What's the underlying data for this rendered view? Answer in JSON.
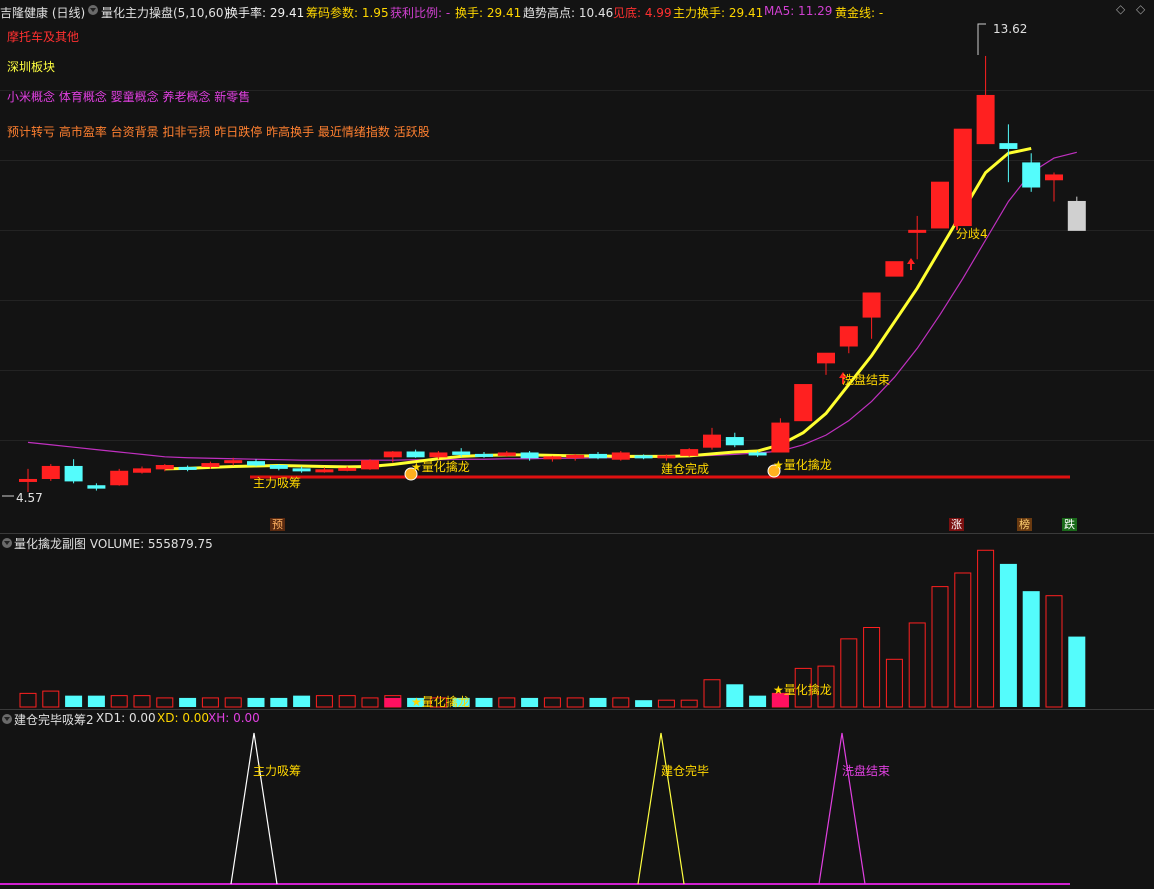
{
  "header": {
    "stock_title": "吉隆健康 (日线)",
    "indicator": "量化主力操盘(5,10,60)",
    "turnover": "换手率: 29.41",
    "chip_param": "筹码参数: 1.95",
    "profit_ratio": "获利比例: -",
    "hand": "换手: 29.41",
    "trend_high": "趋势高点: 10.46",
    "bottom": "见底: 4.99",
    "main_hand": "主力换手: 29.41",
    "ma5": "MA5: 11.29",
    "gold_line": "黄金线: -"
  },
  "tags": {
    "line1": "摩托车及其他",
    "line2": "深圳板块",
    "line3": "小米概念  体育概念  婴童概念  养老概念  新零售",
    "line4": "预计转亏  高市盈率  台资背景  扣非亏损  昨日跌停  昨高换手  最近情绪指数  活跃股"
  },
  "price_labels": {
    "high": "13.62",
    "low": "4.57"
  },
  "annotations": {
    "accum": "主力吸筹",
    "qinlong1": "★量化擒龙",
    "jiancang": "建仓完成",
    "qinlong2": "★量化擒龙",
    "xipan": "洗盘结束",
    "fenqi": "分歧4"
  },
  "bottom_tags": {
    "yu": "预",
    "zhang": "涨",
    "bang": "榜",
    "die": "跌"
  },
  "volume_panel": {
    "title": "量化擒龙副图  VOLUME: 555879.75",
    "qinlong1": "★量化擒龙",
    "qinlong2": "★量化擒龙"
  },
  "sub_panel": {
    "title": "建仓完毕吸筹2",
    "xd1": "XD1: 0.00",
    "xd": "XD: 0.00",
    "xh": "XH: 0.00",
    "peak1": "主力吸筹",
    "peak2": "建仓完毕",
    "peak3": "洗盘结束"
  },
  "colors": {
    "up": "#ff2020",
    "down": "#54fcfc",
    "ma_yellow": "#ffff30",
    "ma_magenta": "#c030c0",
    "support": "#e01010"
  },
  "chart_data": {
    "type": "candlestick",
    "candles": [
      {
        "o": 4.8,
        "h": 5.05,
        "l": 4.57,
        "c": 4.83
      },
      {
        "o": 4.85,
        "h": 5.15,
        "l": 4.8,
        "c": 5.1
      },
      {
        "o": 5.1,
        "h": 5.25,
        "l": 4.75,
        "c": 4.8
      },
      {
        "o": 4.7,
        "h": 4.75,
        "l": 4.6,
        "c": 4.65
      },
      {
        "o": 4.72,
        "h": 5.05,
        "l": 4.7,
        "c": 5.0
      },
      {
        "o": 4.98,
        "h": 5.1,
        "l": 4.95,
        "c": 5.05
      },
      {
        "o": 5.05,
        "h": 5.15,
        "l": 5.0,
        "c": 5.12
      },
      {
        "o": 5.08,
        "h": 5.12,
        "l": 5.0,
        "c": 5.06
      },
      {
        "o": 5.1,
        "h": 5.2,
        "l": 5.05,
        "c": 5.16
      },
      {
        "o": 5.18,
        "h": 5.28,
        "l": 5.12,
        "c": 5.22
      },
      {
        "o": 5.2,
        "h": 5.25,
        "l": 5.1,
        "c": 5.13
      },
      {
        "o": 5.12,
        "h": 5.15,
        "l": 5.02,
        "c": 5.06
      },
      {
        "o": 5.05,
        "h": 5.1,
        "l": 4.97,
        "c": 5.02
      },
      {
        "o": 5.02,
        "h": 5.08,
        "l": 4.97,
        "c": 5.03
      },
      {
        "o": 5.04,
        "h": 5.1,
        "l": 5.0,
        "c": 5.06
      },
      {
        "o": 5.05,
        "h": 5.25,
        "l": 5.03,
        "c": 5.22
      },
      {
        "o": 5.3,
        "h": 5.42,
        "l": 5.18,
        "c": 5.4
      },
      {
        "o": 5.4,
        "h": 5.45,
        "l": 5.28,
        "c": 5.3
      },
      {
        "o": 5.3,
        "h": 5.42,
        "l": 5.25,
        "c": 5.38
      },
      {
        "o": 5.4,
        "h": 5.48,
        "l": 5.3,
        "c": 5.35
      },
      {
        "o": 5.35,
        "h": 5.4,
        "l": 5.28,
        "c": 5.32
      },
      {
        "o": 5.33,
        "h": 5.42,
        "l": 5.3,
        "c": 5.38
      },
      {
        "o": 5.38,
        "h": 5.42,
        "l": 5.22,
        "c": 5.28
      },
      {
        "o": 5.26,
        "h": 5.32,
        "l": 5.2,
        "c": 5.3
      },
      {
        "o": 5.28,
        "h": 5.36,
        "l": 5.22,
        "c": 5.33
      },
      {
        "o": 5.35,
        "h": 5.4,
        "l": 5.25,
        "c": 5.28
      },
      {
        "o": 5.25,
        "h": 5.42,
        "l": 5.22,
        "c": 5.38
      },
      {
        "o": 5.32,
        "h": 5.35,
        "l": 5.25,
        "c": 5.3
      },
      {
        "o": 5.28,
        "h": 5.35,
        "l": 5.22,
        "c": 5.32
      },
      {
        "o": 5.33,
        "h": 5.48,
        "l": 5.3,
        "c": 5.45
      },
      {
        "o": 5.5,
        "h": 5.9,
        "l": 5.45,
        "c": 5.75
      },
      {
        "o": 5.7,
        "h": 5.8,
        "l": 5.5,
        "c": 5.55
      },
      {
        "o": 5.38,
        "h": 5.42,
        "l": 5.3,
        "c": 5.35
      },
      {
        "o": 5.4,
        "h": 6.1,
        "l": 5.4,
        "c": 6.0
      },
      {
        "o": 6.05,
        "h": 6.8,
        "l": 6.05,
        "c": 6.8
      },
      {
        "o": 7.25,
        "h": 7.45,
        "l": 7.0,
        "c": 7.45
      },
      {
        "o": 7.6,
        "h": 8.0,
        "l": 7.45,
        "c": 8.0
      },
      {
        "o": 8.2,
        "h": 8.7,
        "l": 7.75,
        "c": 8.7
      },
      {
        "o": 9.05,
        "h": 9.35,
        "l": 9.05,
        "c": 9.35
      },
      {
        "o": 10.0,
        "h": 10.3,
        "l": 9.4,
        "c": 10.0
      },
      {
        "o": 10.05,
        "h": 11.0,
        "l": 10.05,
        "c": 11.0
      },
      {
        "o": 10.1,
        "h": 12.1,
        "l": 10.1,
        "c": 12.1
      },
      {
        "o": 11.8,
        "h": 13.62,
        "l": 11.8,
        "c": 12.8
      },
      {
        "o": 11.8,
        "h": 12.2,
        "l": 11.0,
        "c": 11.7
      },
      {
        "o": 11.4,
        "h": 11.6,
        "l": 10.8,
        "c": 10.9
      },
      {
        "o": 11.05,
        "h": 11.2,
        "l": 10.6,
        "c": 11.15
      },
      {
        "o": 10.6,
        "h": 10.7,
        "l": 10.0,
        "c": 10.0
      }
    ],
    "volume": [
      6,
      7,
      5,
      5,
      5,
      5,
      4,
      4,
      4,
      4,
      4,
      4,
      5,
      5,
      5,
      4,
      5,
      4,
      4,
      4,
      4,
      4,
      4,
      4,
      4,
      4,
      4,
      3,
      3,
      3,
      12,
      10,
      5,
      6,
      17,
      18,
      30,
      35,
      21,
      37,
      53,
      59,
      69,
      63,
      51,
      49,
      31
    ],
    "ylim": [
      4.3,
      14.2
    ],
    "ma_yellow": [
      null,
      null,
      null,
      null,
      null,
      null,
      5.05,
      5.06,
      5.08,
      5.1,
      5.11,
      5.12,
      5.11,
      5.1,
      5.09,
      5.1,
      5.14,
      5.2,
      5.26,
      5.31,
      5.33,
      5.34,
      5.34,
      5.33,
      5.32,
      5.32,
      5.31,
      5.31,
      5.31,
      5.32,
      5.36,
      5.4,
      5.42,
      5.55,
      5.8,
      6.2,
      6.8,
      7.4,
      8.1,
      8.8,
      9.6,
      10.4,
      11.2,
      11.6,
      11.7,
      null,
      null
    ],
    "ma_magenta": [
      5.6,
      5.55,
      5.5,
      5.45,
      5.4,
      5.35,
      5.3,
      5.28,
      5.27,
      5.26,
      5.25,
      5.24,
      5.23,
      5.23,
      5.23,
      5.23,
      5.23,
      5.24,
      5.24,
      5.25,
      5.25,
      5.26,
      5.26,
      5.27,
      5.27,
      5.28,
      5.28,
      5.29,
      5.3,
      5.31,
      5.33,
      5.35,
      5.38,
      5.42,
      5.55,
      5.75,
      6.05,
      6.45,
      6.95,
      7.55,
      8.25,
      9.0,
      9.8,
      10.6,
      11.2,
      11.5,
      11.62
    ]
  }
}
